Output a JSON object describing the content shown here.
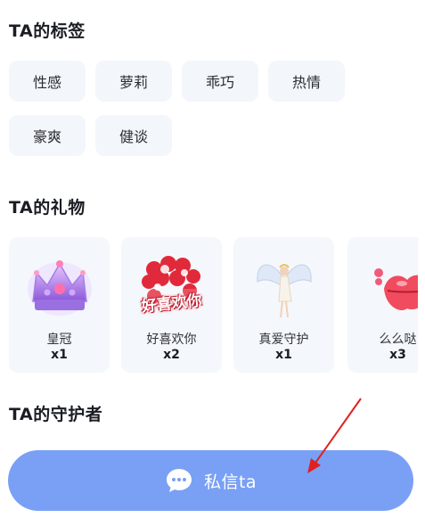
{
  "sections": {
    "tags_title": "TA的标签",
    "gifts_title": "TA的礼物",
    "guardians_title": "TA的守护者"
  },
  "tags": [
    "性感",
    "萝莉",
    "乖巧",
    "热情",
    "豪爽",
    "健谈"
  ],
  "gifts": [
    {
      "name": "皇冠",
      "count": "x1",
      "icon": "crown-icon"
    },
    {
      "name": "好喜欢你",
      "count": "x2",
      "icon": "heart-balloons-icon",
      "badge": "好喜欢你"
    },
    {
      "name": "真爱守护",
      "count": "x1",
      "icon": "angel-icon"
    },
    {
      "name": "么么哒",
      "count": "x3",
      "icon": "kiss-lips-icon"
    }
  ],
  "chat_button": {
    "label": "私信ta",
    "icon": "chat-bubble-icon"
  },
  "colors": {
    "button": "#79a0f5",
    "tag_bg": "#f3f6fb",
    "card_bg": "#f4f7fc",
    "annotation_arrow": "#e0201f"
  }
}
